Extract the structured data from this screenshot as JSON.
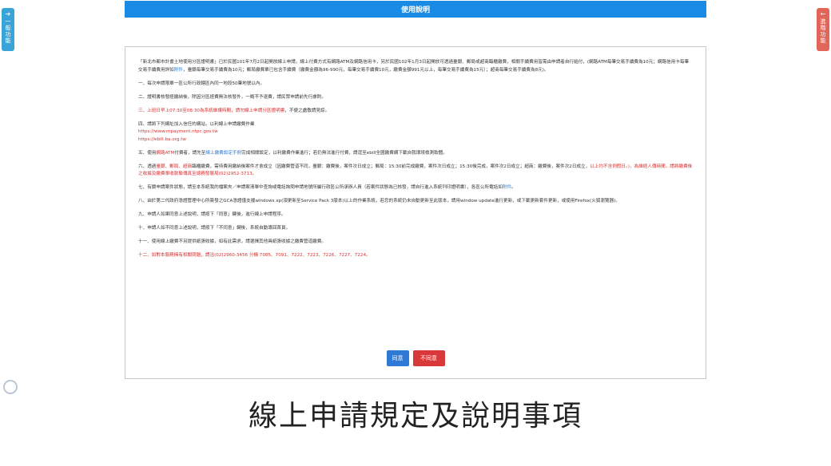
{
  "side_left": {
    "arrow": "➜",
    "chars": [
      "一",
      "般",
      "功",
      "能"
    ]
  },
  "side_right": {
    "arrow": "←",
    "chars": [
      "進",
      "階",
      "功",
      "能"
    ]
  },
  "title": "使用說明",
  "intro": "「新北市都市計畫土地使用分區證明書」已於民國101年7月2日起開放線上申請，線上付費方式有網路ATM及網路信用卡，另於民國102年1月3日起開放可透過臺銀、郵局或超商臨櫃繳費，相關手續費用皆需由申請者自行給付，(網路ATM每筆交易手續費為10元；網路信用卡每筆交易手續費用詳如",
  "intro_link": "附件",
  "intro_tail": "，臺銀每筆交易手續費為10元；郵局繳費單已包含手續費（繳費金額為96-990元，每筆交易手續費10元，繳費金額991元以上，每筆交易手續費為15元）；超商每筆交易手續費為8元)。",
  "item1": "一、每次申請限單一區公所行政轄區內同一地段50筆地號以內。",
  "item2": "二、證明書核發經繳納後，除因分區經費無法核發外，一概不予退費，請民眾申請前先行慮酌。",
  "item3_a": "三、上班日早上07:30至08:30為系統維護時間，",
  "item3_b": "請勿線上申請分區證明書",
  "item3_c": "，不便之處敬請見諒。",
  "item4": "四、請將下列網址加入信任的網站，以利線上申請繳費作業",
  "url1": "https://www.mpayment.ntpc.gov.tw",
  "url2": "https://ebill.ba.org.tw",
  "item5_a": "五、使用",
  "item5_b": "網路ATM",
  "item5_c": "付費者，請先至",
  "item5_d": "線上繳費設定手冊",
  "item5_e": "完成相關設定，以利繳費作業進行；若仍無法進行付費，請逕至ebill全國繳費網下載自我環境檢測軟體。",
  "item6_a": "六、透過",
  "item6_b": "臺銀、郵局、超商",
  "item6_c": "臨櫃繳費，需待費用繳納後案件才會成立（因繳費管道不同，臺銀：繳費後，案件次日成立；郵局：15:30前完成繳費，案件次日成立；15:30後完成，案件次2日成立；超商：繳費後，案件次2日成立，",
  "item6_d": "以上均不含例假日。)，為維經人傳時間，請將繳費後之收據及繳費單收款聯傳真至總務發展局(02)2952-3713。",
  "item7_a": "七、有關申請案件狀態，請至本系統我的檔案夾／申請案清單中查詢或電話詢問申請地號所屬行政區公所承辦人員（若案件狀態為已核發，請自行進入系統列印證明書），各區公所電話如",
  "item7_link": "附件",
  "item7_end": "。",
  "item8": "八、由於第二代政府憑證管理中心所簽發之GCA憑證僅支援windows xp(須更新至Service Pack 3版本)以上的作業系統，若您的系統仍未自動更新至此版本，請用window update進行更新，或下載更新套件更新，或使用Firefox(火狐瀏覽器)。",
  "item9": "九、申請人如果同意上述說明，請按下「同意」鍵後，進行線上申請程序。",
  "item10": "十、申請人如不同意上述說明，請按下「不同意」鍵後，系統自動導回首頁。",
  "item11": "十一、使用線上繳費不另提供紙張收據，如有此需求，請選擇其他具紙張收據之繳費管道繳費。",
  "item12": "十二、如對本服務擁有相關問題，請洽(02)2960-3456 分機 7085、7091、7222、7223、7226、7227、7224。",
  "buttons": {
    "agree": "同意",
    "disagree": "不同意"
  },
  "caption": "線上申請規定及說明事項",
  "colors": {
    "title_bar": "#1a8be4",
    "agree": "#2f79d6",
    "disagree": "#d9383b",
    "left_tab": "#3aa4d8",
    "right_tab": "#e2655a"
  }
}
